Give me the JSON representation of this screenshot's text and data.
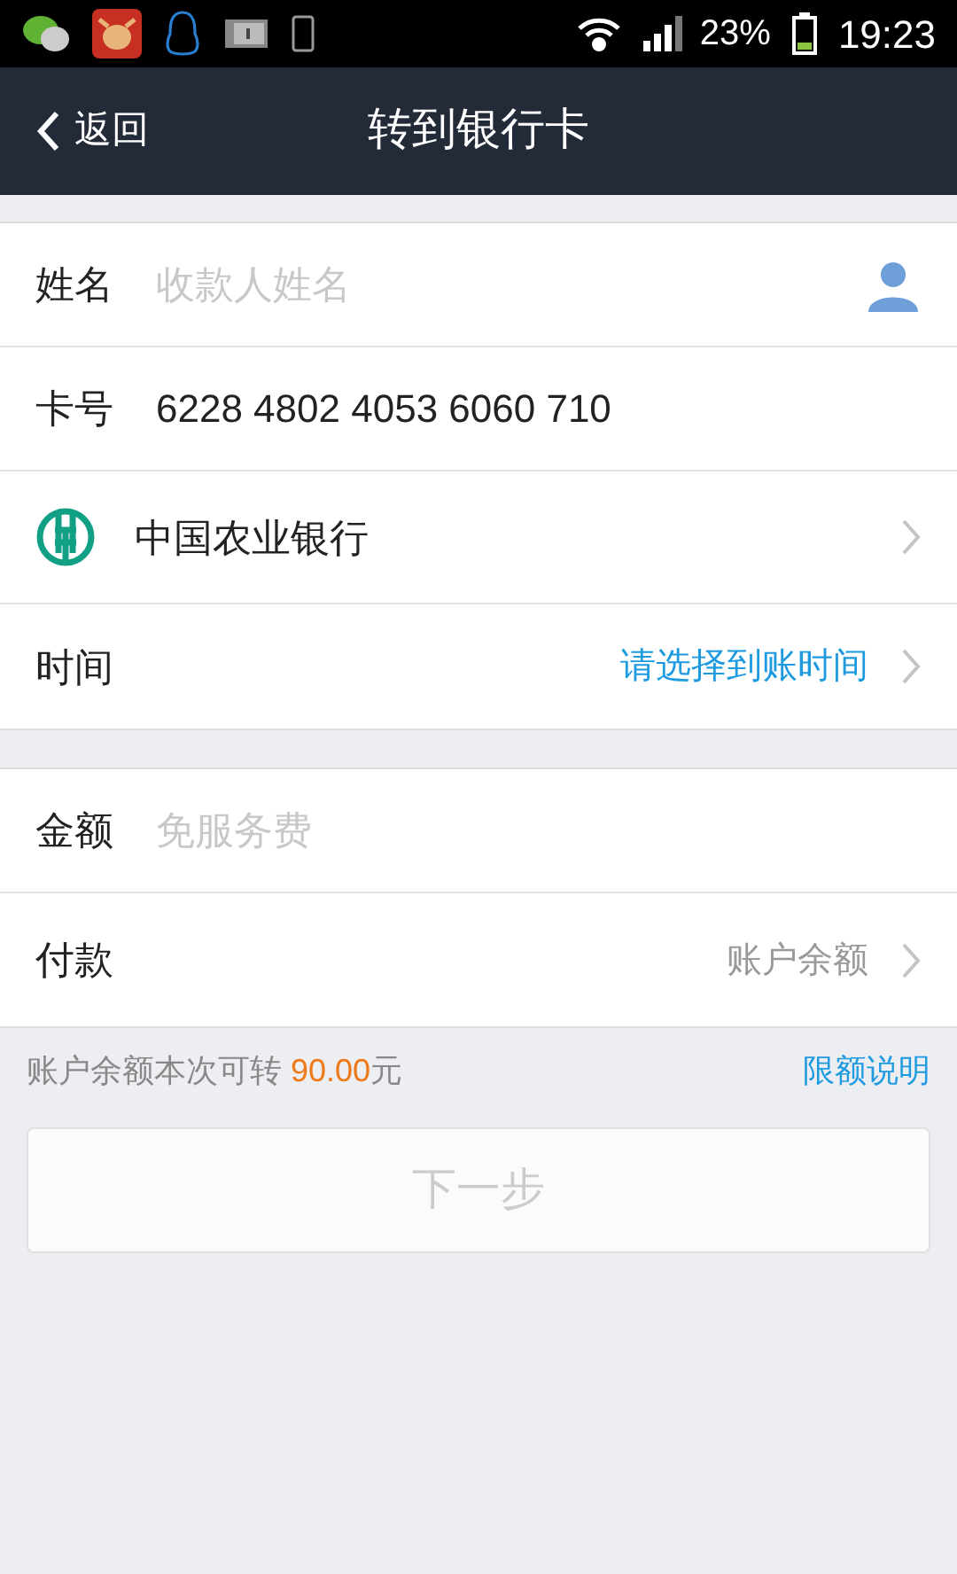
{
  "status_bar": {
    "battery": "23%",
    "time": "19:23"
  },
  "nav": {
    "back": "返回",
    "title": "转到银行卡"
  },
  "sections": [
    {
      "rows": [
        {
          "kind": "input",
          "label": "姓名",
          "placeholder": "收款人姓名",
          "contact_icon": true
        },
        {
          "kind": "input",
          "label": "卡号",
          "value": "6228 4802 4053 6060 710"
        },
        {
          "kind": "bank",
          "label": "中国农业银行"
        },
        {
          "kind": "select",
          "label": "时间",
          "value": "请选择到账时间",
          "highlight": true
        }
      ]
    },
    {
      "rows": [
        {
          "kind": "input",
          "label": "金额",
          "placeholder": "免服务费"
        },
        {
          "kind": "select",
          "label": "付款",
          "value": "账户余额",
          "highlight": false
        }
      ]
    }
  ],
  "balance_note": {
    "prefix": "账户余额本次可转 ",
    "amount": "90.00",
    "suffix": "元",
    "link": "限额说明"
  },
  "next_button": {
    "label": "下一步",
    "disabled": true
  }
}
